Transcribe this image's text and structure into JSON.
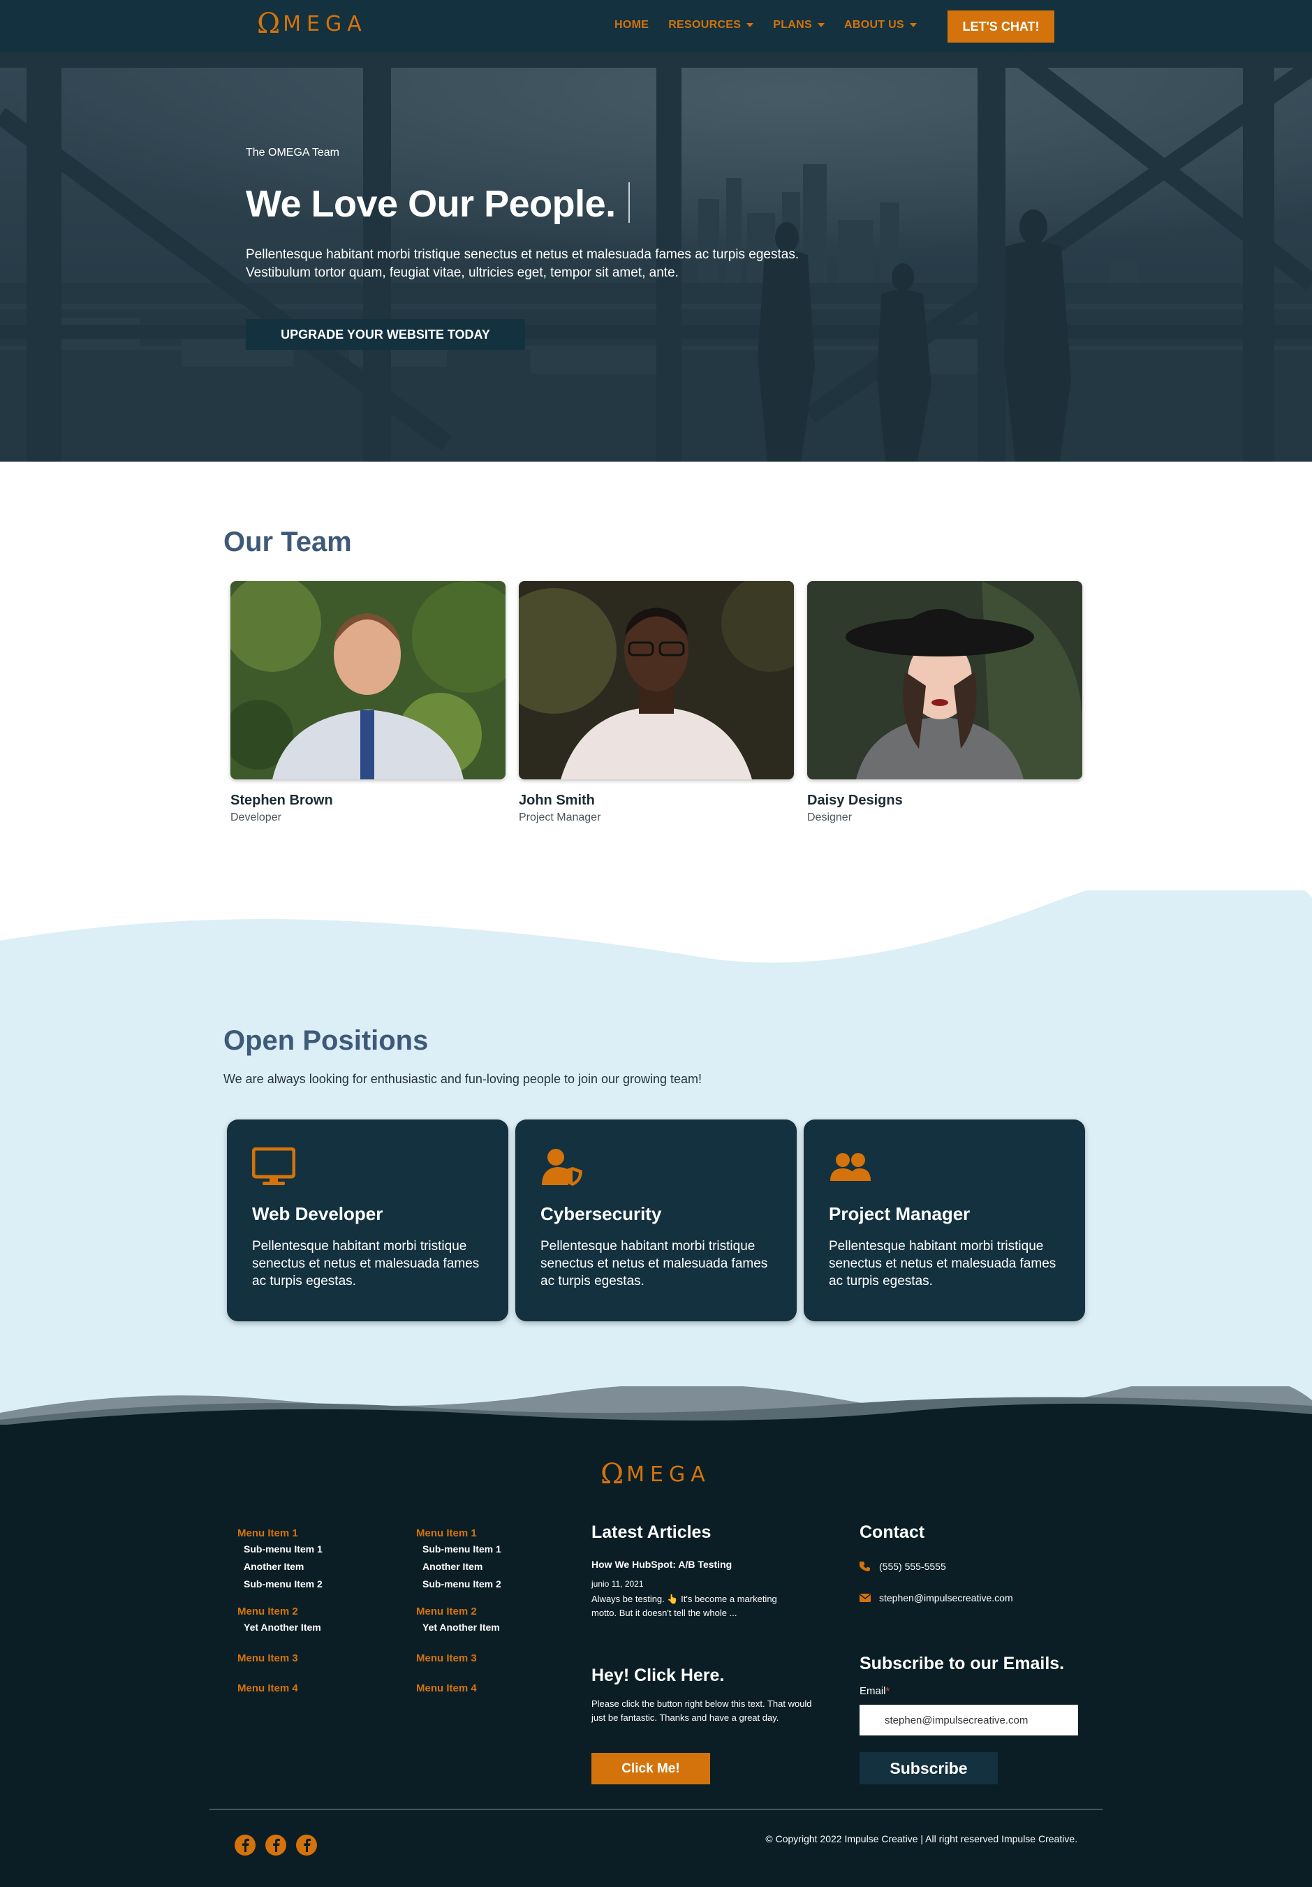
{
  "brand": {
    "logo_omega": "Ω",
    "logo_rest": "MEGA",
    "accent": "#d4730b",
    "navy": "#13313f"
  },
  "nav": {
    "items": [
      {
        "label": "HOME",
        "dropdown": false
      },
      {
        "label": "RESOURCES",
        "dropdown": true
      },
      {
        "label": "PLANS",
        "dropdown": true
      },
      {
        "label": "ABOUT US",
        "dropdown": true
      }
    ],
    "cta": "LET'S CHAT!"
  },
  "hero": {
    "eyebrow": "The OMEGA Team",
    "title": "We Love Our People.",
    "body": "Pellentesque habitant morbi tristique senectus et netus et malesuada fames ac turpis egestas. Vestibulum tortor quam, feugiat vitae, ultricies eget, tempor sit amet, ante.",
    "button": "UPGRADE YOUR WEBSITE TODAY"
  },
  "team": {
    "title": "Our Team",
    "members": [
      {
        "name": "Stephen Brown",
        "role": "Developer"
      },
      {
        "name": "John Smith",
        "role": "Project Manager"
      },
      {
        "name": "Daisy Designs",
        "role": "Designer"
      }
    ]
  },
  "positions": {
    "title": "Open Positions",
    "subtitle": "We are always looking for enthusiastic and fun-loving people to join our growing team!",
    "cards": [
      {
        "icon": "monitor-icon",
        "title": "Web Developer",
        "body": "Pellentesque habitant morbi tristique senectus et netus et malesuada fames ac turpis egestas."
      },
      {
        "icon": "user-shield-icon",
        "title": "Cybersecurity",
        "body": "Pellentesque habitant morbi tristique senectus et netus et malesuada fames ac turpis egestas."
      },
      {
        "icon": "users-icon",
        "title": "Project Manager",
        "body": "Pellentesque habitant morbi tristique senectus et netus et malesuada fames ac turpis egestas."
      }
    ]
  },
  "footer": {
    "menus": [
      {
        "groups": [
          {
            "label": "Menu Item 1",
            "subs": [
              "Sub-menu Item 1",
              "Another Item",
              "Sub-menu Item 2"
            ]
          },
          {
            "label": "Menu Item 2",
            "subs": [
              "Yet Another Item"
            ]
          },
          {
            "label": "Menu Item 3",
            "subs": []
          },
          {
            "label": "Menu Item 4",
            "subs": []
          }
        ]
      },
      {
        "groups": [
          {
            "label": "Menu Item 1",
            "subs": [
              "Sub-menu Item 1",
              "Another Item",
              "Sub-menu Item 2"
            ]
          },
          {
            "label": "Menu Item 2",
            "subs": [
              "Yet Another Item"
            ]
          },
          {
            "label": "Menu Item 3",
            "subs": []
          },
          {
            "label": "Menu Item 4",
            "subs": []
          }
        ]
      }
    ],
    "articles": {
      "title": "Latest Articles",
      "post_title": "How We HubSpot: A/B Testing",
      "post_date": "junio 11, 2021",
      "post_excerpt": "Always be testing. 👆 It's become a marketing motto. But it doesn't tell the whole ..."
    },
    "cta": {
      "title": "Hey! Click Here.",
      "body": "Please click the button right below this text. That would just be fantastic. Thanks and have a great day.",
      "button": "Click Me!"
    },
    "contact": {
      "title": "Contact",
      "phone": "(555) 555-5555",
      "email": "stephen@impulsecreative.com"
    },
    "subscribe": {
      "title": "Subscribe to our Emails.",
      "label": "Email",
      "required_mark": "*",
      "value": "stephen@impulsecreative.com",
      "button": "Subscribe"
    },
    "socials": [
      "facebook-icon",
      "facebook-icon",
      "facebook-icon"
    ],
    "copyright": "© Copyright 2022 Impulse Creative | All right reserved Impulse Creative."
  }
}
